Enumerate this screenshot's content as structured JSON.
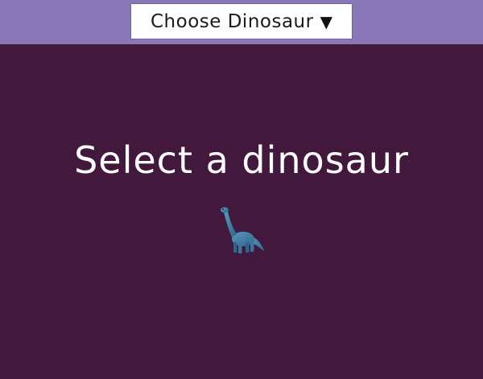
{
  "header": {
    "dropdown_label": "Choose Dinosaur",
    "dropdown_caret": "▼"
  },
  "main": {
    "heading": "Select a dinosaur",
    "dinosaur_icon": "sauropod-icon"
  },
  "colors": {
    "background": "#43183d",
    "header_bar": "#8878b8",
    "dropdown_bg": "#ffffff",
    "heading_text": "#ffffff",
    "dinosaur": "#3f7fa6"
  }
}
